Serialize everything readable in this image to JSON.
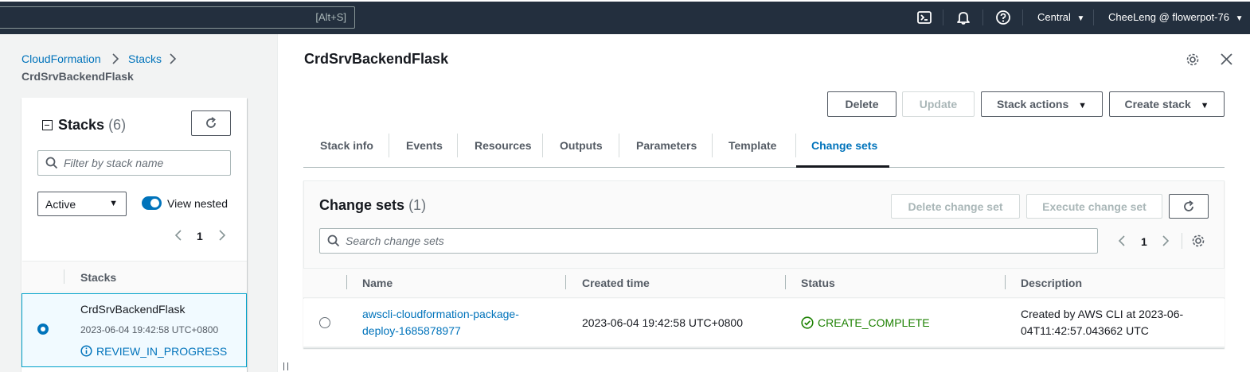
{
  "topbar": {
    "search_shortcut": "[Alt+S]",
    "region": "Central",
    "account": "CheeLeng @ flowerpot-76",
    "icons": [
      "cloudshell-icon",
      "notifications-icon",
      "help-icon"
    ]
  },
  "breadcrumb": {
    "root": "CloudFormation",
    "stacks": "Stacks",
    "current": "CrdSrvBackendFlask"
  },
  "left": {
    "title": "Stacks",
    "count": "(6)",
    "filter_placeholder": "Filter by stack name",
    "status_filter": "Active",
    "view_nested_label": "View nested",
    "page": "1",
    "column_header": "Stacks",
    "stacks": [
      {
        "name": "CrdSrvBackendFlask",
        "time": "2023-06-04 19:42:58 UTC+0800",
        "status": "REVIEW_IN_PROGRESS"
      }
    ]
  },
  "detail": {
    "title": "CrdSrvBackendFlask",
    "actions": {
      "delete": "Delete",
      "update": "Update",
      "stack_actions": "Stack actions",
      "create_stack": "Create stack"
    },
    "tabs": [
      "Stack info",
      "Events",
      "Resources",
      "Outputs",
      "Parameters",
      "Template",
      "Change sets"
    ],
    "active_tab": "Change sets"
  },
  "change_sets": {
    "title": "Change sets",
    "count": "(1)",
    "delete_label": "Delete change set",
    "execute_label": "Execute change set",
    "search_placeholder": "Search change sets",
    "page": "1",
    "columns": [
      "Name",
      "Created time",
      "Status",
      "Description"
    ],
    "rows": [
      {
        "name_line1": "awscli-cloudformation-package-",
        "name_line2": "deploy-1685878977",
        "created": "2023-06-04 19:42:58 UTC+0800",
        "status": "CREATE_COMPLETE",
        "desc_line1": "Created by AWS CLI at 2023-06-",
        "desc_line2": "04T11:42:57.043662 UTC"
      }
    ]
  },
  "colors": {
    "nav": "#232f3e",
    "link": "#0073bb",
    "success": "#1d8102",
    "text": "#16191f"
  }
}
